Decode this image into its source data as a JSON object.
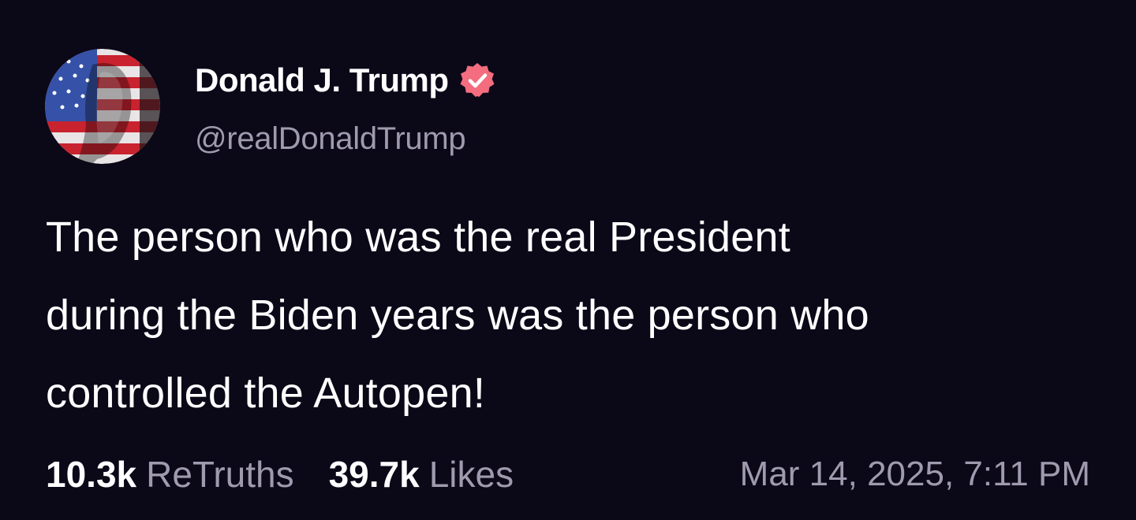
{
  "author": {
    "display_name": "Donald J. Trump",
    "handle": "@realDonaldTrump",
    "verified": true,
    "avatar_icon": "flag-painted-portrait-avatar",
    "verified_icon": "verified-badge-icon"
  },
  "post": {
    "lines": [
      "The person who was the real President",
      "during the Biden years was the person who",
      "controlled the Autopen!"
    ]
  },
  "stats": {
    "retruths_count": "10.3k",
    "retruths_label": "ReTruths",
    "likes_count": "39.7k",
    "likes_label": "Likes",
    "timestamp": "Mar 14, 2025, 7:11 PM"
  },
  "colors": {
    "background": "#0b0818",
    "primary_text": "#ffffff",
    "secondary_text": "#a09aae",
    "verified_badge": "#f36d7e"
  }
}
